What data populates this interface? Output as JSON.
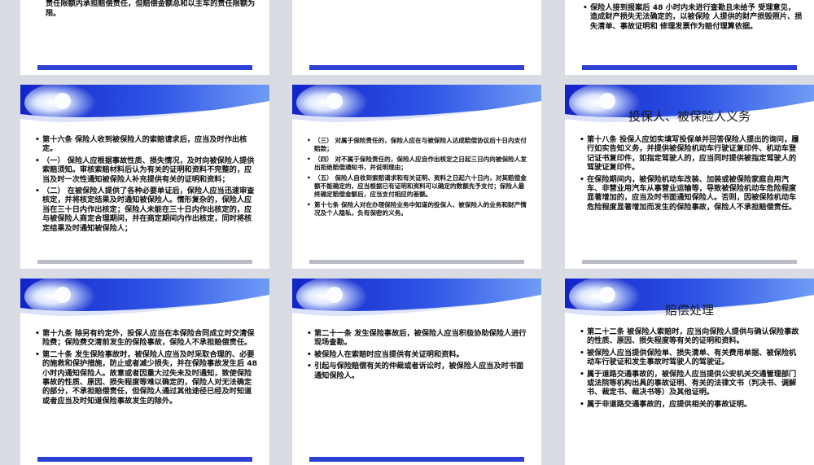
{
  "slides": [
    {
      "id": "r0c0",
      "paragraphs": [
        {
          "bullet": false,
          "text": "险单上载明的机动车第三者责任保险责任限额的比例，在各自的责任限额内承担赔偿责任，但赔偿金额总和以主车的责任限额为限。"
        }
      ]
    },
    {
      "id": "r0c1",
      "paragraphs": []
    },
    {
      "id": "r0c2",
      "paragraphs": [
        {
          "bullet": true,
          "text": "保险人接到报案后 48 小时内未进行查勘且未给予 受理意见，造成财产损失无法确定的，以被保险 人提供的财产损毁照片、损失清单、事故证明和 修理发票作为赔付理算依据。"
        }
      ]
    },
    {
      "id": "r1c0",
      "paragraphs": [
        {
          "bullet": true,
          "text": "第十六条 保险人收到被保险人的索赔请求后，应当及时作出核定。"
        },
        {
          "bullet": true,
          "text": "（一） 保险人应根据事故性质、损失情况，及时向被保险人提供索赔须知。审核索赔材料后认为有关的证明和资料不完整的，应当及时一次性通知被保险人补充提供有关的证明和资料；"
        },
        {
          "bullet": true,
          "text": "（二） 在被保险人提供了各种必要单证后，保险人应当迅速审查核定，并将核定结果及时通知被保险人。情形复杂的，保险人应当在三十日内作出核定；保险人未能在三十日内作出核定的，应与被保险人商定合理期间，并在商定期间内作出核定，同时将核定结果及时通知被保险人；"
        }
      ]
    },
    {
      "id": "r1c1",
      "paragraphs": [
        {
          "bullet": true,
          "text": "（三） 对属于保险责任的，保险人应在与被保险人达成赔偿协议后十日内支付赔款；"
        },
        {
          "bullet": true,
          "text": "（四） 对不属于保险责任的，保险人应自作出核定之日起三日内向被保险人发出拒绝赔偿通知书，并说明理由；"
        },
        {
          "bullet": true,
          "text": "（五） 保险人自收到索赔请求和有关证明、资料之日起六十日内，对其赔偿金额不能确定的，应当根据已有证明和资料可以确定的数额先予支付；保险人最终确定赔偿金额后，应当支付相应的差额。"
        },
        {
          "bullet": true,
          "text": "第十七条 保险人对在办理保险业务中知道的投保人、被保险人的业务和财产情况及个人隐私，负有保密的义务。"
        }
      ]
    },
    {
      "id": "r1c2",
      "title": "投保人、被保险人义务",
      "paragraphs": [
        {
          "bullet": true,
          "text": "第十八条 投保人应如实填写投保单并回答保险人提出的询问，履行如实告知义务，并提供被保险机动车行驶证复印件、机动车登记证书复印件，如指定驾驶人的，应当同时提供被指定驾驶人的驾驶证复印件。"
        },
        {
          "bullet": true,
          "text": "在保险期间内，被保险机动车改装、加装或被保险家庭自用汽车、非营业用汽车从事营业运输等，导致被保险机动车危险程度显著增加的，应当及时书面通知保险人。否则，因被保险机动车危险程度显著增加而发生的保险事故，保险人不承担赔偿责任。"
        }
      ]
    },
    {
      "id": "r2c0",
      "paragraphs": [
        {
          "bullet": true,
          "text": "第十九条 除另有约定外，投保人应当在本保险合同成立时交清保险费；保险费交清前发生的保险事故，保险人不承担赔偿责任。"
        },
        {
          "bullet": true,
          "text": "第二十条 发生保险事故时，被保险人应当及时采取合理的、必要的施救和保护措施，防止或者减少损失，并在保险事故发生后 48 小时内通知保险人。故意或者因重大过失未及时通知，致使保险事故的性质、原因、损失程度等难以确定的，保险人对无法确定的部分，不承担赔偿责任，但保险人通过其他途径已经及时知道或者应当及时知道保险事故发生的除外。"
        }
      ]
    },
    {
      "id": "r2c1",
      "paragraphs": [
        {
          "bullet": true,
          "text": "第二十一条 发生保险事故后，被保险人应当积极协助保险人进行现场查勘。"
        },
        {
          "bullet": true,
          "text": "被保险人在索赔时应当提供有关证明和资料。"
        },
        {
          "bullet": true,
          "text": "引起与保险赔偿有关的仲裁或者诉讼时，被保险人应当及时书面通知保险人。"
        }
      ]
    },
    {
      "id": "r2c2",
      "title": "赔偿处理",
      "paragraphs": [
        {
          "bullet": true,
          "text": "第二十二条 被保险人索赔时，应当向保险人提供与确认保险事故的性质、原因、损失程度等有关的证明和资料。"
        },
        {
          "bullet": true,
          "text": "被保险人应当提供保险单、损失清单、有关费用单据、被保险机动车行驶证和发生事故时驾驶人的驾驶证。"
        },
        {
          "bullet": true,
          "text": "属于道路交通事故的，被保险人应当提供公安机关交通管理部门或法院等机构出具的事故证明、有关的法律文书（判决书、调解书、裁定书、裁决书等）及其他证明。"
        },
        {
          "bullet": true,
          "text": "属于非道路交通事故的，应提供相关的事故证明。"
        }
      ]
    }
  ]
}
